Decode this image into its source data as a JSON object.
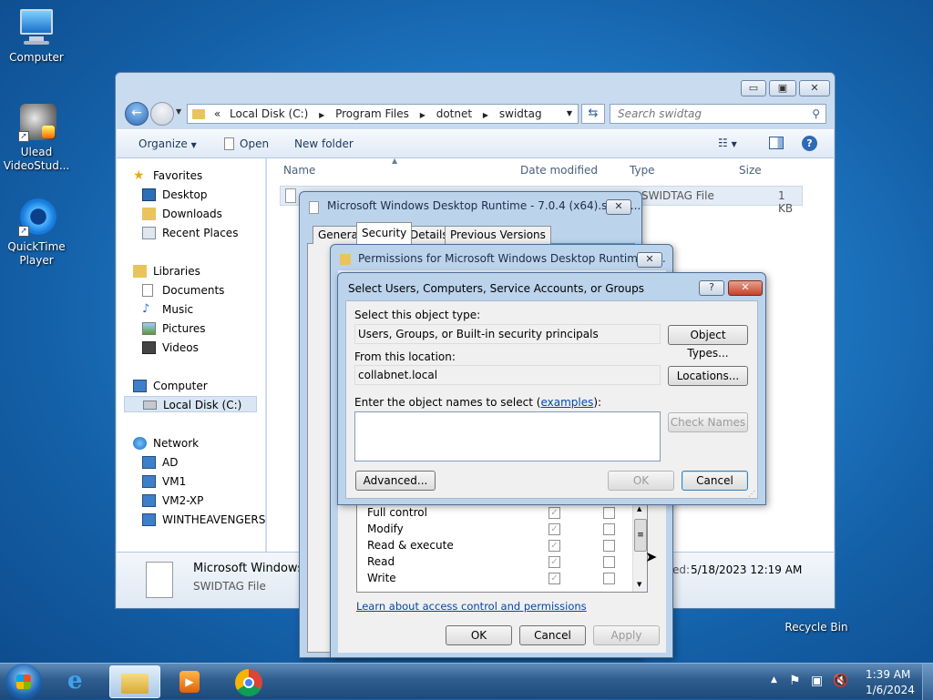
{
  "desktop": {
    "icons": [
      {
        "label": "Computer",
        "icon": "computer-icon"
      },
      {
        "label": "Ulead VideoStud...",
        "icon": "ulead-icon"
      },
      {
        "label": "QuickTime Player",
        "icon": "quicktime-icon"
      },
      {
        "label": "Recycle Bin",
        "icon": "recycle-bin-icon"
      }
    ]
  },
  "explorer": {
    "address": {
      "chevrons": "«",
      "parts": [
        "Local Disk (C:)",
        "Program Files",
        "dotnet",
        "swidtag"
      ]
    },
    "search_placeholder": "Search swidtag",
    "toolbar": {
      "organize": "Organize",
      "open": "Open",
      "new_folder": "New folder"
    },
    "nav": {
      "favorites": "Favorites",
      "desktop": "Desktop",
      "downloads": "Downloads",
      "recent": "Recent Places",
      "libraries": "Libraries",
      "documents": "Documents",
      "music": "Music",
      "pictures": "Pictures",
      "videos": "Videos",
      "computer": "Computer",
      "local_disk": "Local Disk (C:)",
      "network": "Network",
      "ad": "AD",
      "vm1": "VM1",
      "vm2": "VM2-XP",
      "winth": "WINTHEAVENGERS"
    },
    "columns": {
      "name": "Name",
      "date": "Date modified",
      "type": "Type",
      "size": "Size"
    },
    "file": {
      "type": "SWIDTAG File",
      "size": "1 KB"
    },
    "details": {
      "name": "Microsoft Windows",
      "type": "SWIDTAG File",
      "date_label": "ed:",
      "date": "5/18/2023 12:19 AM"
    }
  },
  "props": {
    "title": "Microsoft Windows Desktop Runtime - 7.0.4 (x64).swidt...",
    "tabs": [
      "General",
      "Security",
      "Details",
      "Previous Versions"
    ]
  },
  "perm": {
    "title": "Permissions for Microsoft Windows Desktop Runtime - ...",
    "rows": [
      "Full control",
      "Modify",
      "Read & execute",
      "Read",
      "Write"
    ],
    "learn": "Learn about access control and permissions",
    "ok": "OK",
    "cancel": "Cancel",
    "apply": "Apply"
  },
  "select": {
    "title": "Select Users, Computers, Service Accounts, or Groups",
    "help": "?",
    "close": "✕",
    "obj_type_label": "Select this object type:",
    "obj_type_value": "Users, Groups, or Built-in security principals",
    "obj_type_btn": "Object Types...",
    "location_label": "From this location:",
    "location_value": "collabnet.local",
    "location_btn": "Locations...",
    "names_label_pre": "Enter the object names to select (",
    "names_link": "examples",
    "names_label_post": "):",
    "check_btn": "Check Names",
    "advanced_btn": "Advanced...",
    "ok_btn": "OK",
    "cancel_btn": "Cancel"
  },
  "taskbar": {
    "time": "1:39 AM",
    "date": "1/6/2024"
  }
}
